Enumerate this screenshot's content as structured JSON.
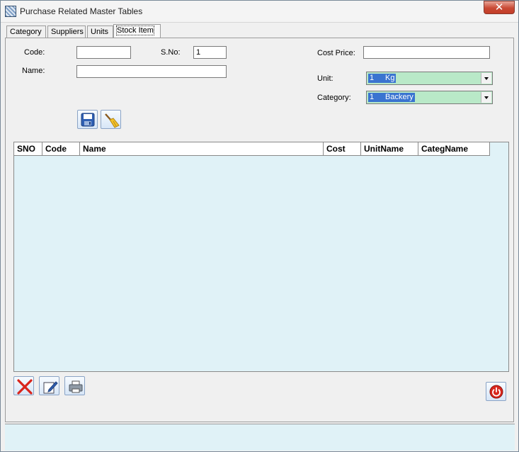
{
  "window": {
    "title": "Purchase Related Master Tables",
    "close_label": "✕"
  },
  "tabs": [
    {
      "label": "Category"
    },
    {
      "label": "Suppliers"
    },
    {
      "label": "Units"
    },
    {
      "label": "Stock Item"
    }
  ],
  "form": {
    "code_label": "Code:",
    "code_value": "",
    "sno_label": "S.No:",
    "sno_value": "1",
    "name_label": "Name:",
    "name_value": "",
    "cost_price_label": "Cost Price:",
    "cost_price_value": "",
    "unit_label": "Unit:",
    "unit_selected_id": "1",
    "unit_selected_name": "Kg",
    "category_label": "Category:",
    "category_selected_id": "1",
    "category_selected_name": "Backery"
  },
  "icons": {
    "save": "floppy-disk-icon",
    "clear": "broom-icon",
    "delete": "red-x-icon",
    "edit": "pencil-icon",
    "print": "printer-icon",
    "exit": "power-icon"
  },
  "grid": {
    "columns": [
      "SNO",
      "Code",
      "Name",
      "Cost",
      "UnitName",
      "CategName"
    ],
    "rows": []
  },
  "colors": {
    "grid_bg": "#e0f2f7",
    "combo_bg": "#b9e9c8",
    "selection": "#3a74d0",
    "close_red": "#c94a35"
  }
}
